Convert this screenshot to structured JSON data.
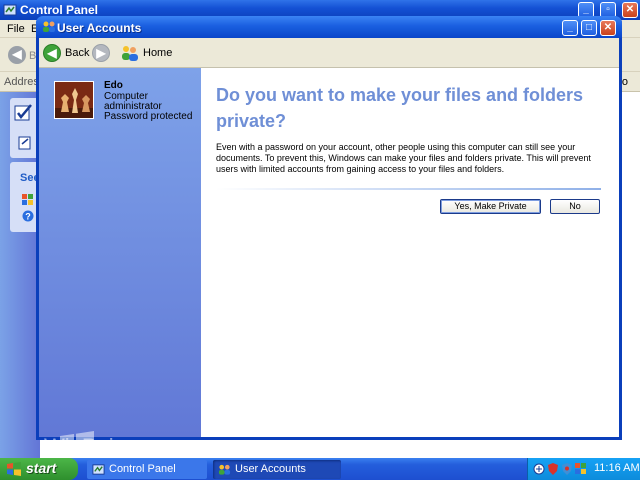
{
  "control_panel": {
    "title": "Control Panel",
    "menu": [
      "File",
      "E"
    ],
    "back_partial": "B",
    "address_label": "Address",
    "go_partial": "So",
    "see_also_partial": "See"
  },
  "user_accounts": {
    "title": "User Accounts",
    "toolbar": {
      "back_label": "Back",
      "home_label": "Home"
    },
    "user": {
      "name": "Edo",
      "role_line1": "Computer",
      "role_line2": "administrator",
      "status": "Password protected"
    },
    "question": "Do you want to make your files and folders private?",
    "description": "Even with a password on your account, other people using this computer can still see your documents. To prevent this, Windows can make your files and folders private. This will prevent users with limited accounts from gaining access to your files and folders.",
    "buttons": {
      "yes_label": "Yes, Make Private",
      "no_label": "No"
    }
  },
  "taskbar": {
    "start_label": "start",
    "items": [
      {
        "label": "Control Panel",
        "active": false
      },
      {
        "label": "User Accounts",
        "active": true
      }
    ],
    "clock": "11:16 AM"
  },
  "watermark": "WinPoin",
  "colors": {
    "xp_blue": "#0b3fbb",
    "heading": "#6f8fd6",
    "start_green": "#2e8f2d",
    "tray_blue": "#0d8cdb"
  }
}
